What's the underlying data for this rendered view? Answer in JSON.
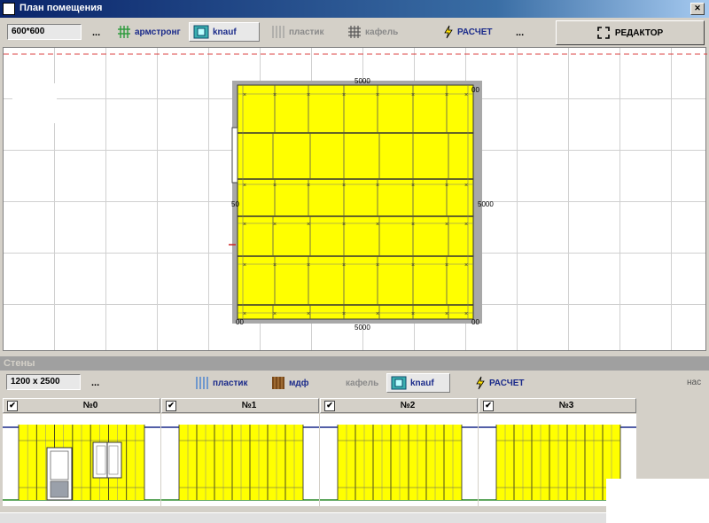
{
  "window": {
    "title": "План помещения"
  },
  "plan_toolbar": {
    "size_value": "600*600",
    "more": "...",
    "buttons": [
      {
        "label": "армстронг",
        "icon": "grid-icon",
        "state": "normal"
      },
      {
        "label": "knauf",
        "icon": "knauf-icon",
        "state": "active"
      },
      {
        "label": "пластик",
        "icon": "stripes-icon",
        "state": "disabled"
      },
      {
        "label": "кафель",
        "icon": "tile-icon",
        "state": "disabled"
      }
    ],
    "calc_label": "РАСЧЕТ",
    "more2": "...",
    "editor_label": "РЕДАКТОР"
  },
  "plan": {
    "dim_top": "5000",
    "dim_bottom": "5000",
    "dim_right": "5000",
    "dim_left": "50",
    "corner_tr": "00",
    "corner_bl": "00",
    "corner_br": "00",
    "panel_color": "#ffff00",
    "wall_color": "#a8a8a8"
  },
  "walls_section": {
    "title": "Стены",
    "size_value": "1200 x 2500",
    "more": "...",
    "buttons": [
      {
        "label": "пластик",
        "icon": "stripes-blue-icon",
        "state": "normal"
      },
      {
        "label": "мдф",
        "icon": "mdf-icon",
        "state": "normal"
      },
      {
        "label": "кафель",
        "icon": "",
        "state": "disabled"
      },
      {
        "label": "knauf",
        "icon": "knauf-icon",
        "state": "active"
      }
    ],
    "calc_label": "РАСЧЕТ",
    "cut_label": "нас",
    "walls": [
      {
        "label": "№0",
        "checked": "✔"
      },
      {
        "label": "№1",
        "checked": "✔"
      },
      {
        "label": "№2",
        "checked": "✔"
      },
      {
        "label": "№3",
        "checked": "✔"
      }
    ]
  }
}
